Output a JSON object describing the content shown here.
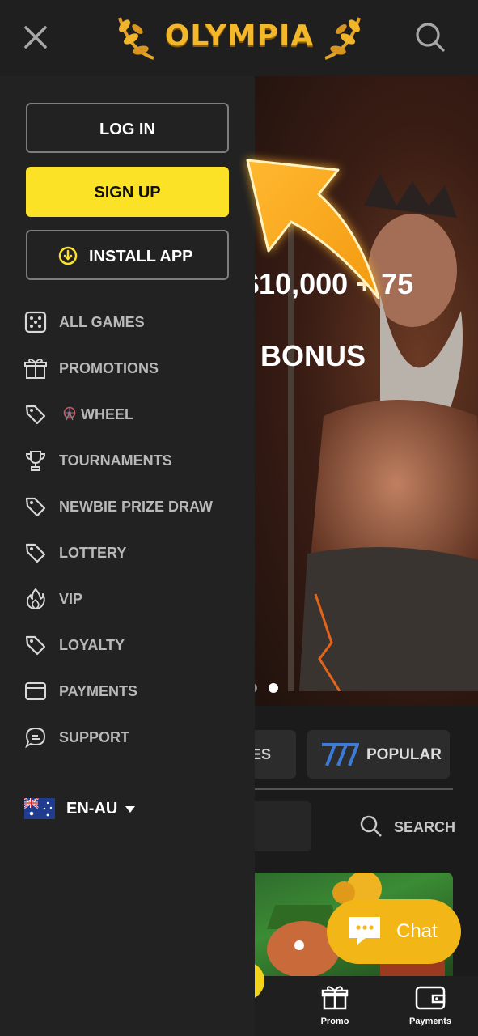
{
  "header": {
    "logo_text": "OLYMPIA",
    "close_icon": "close-icon",
    "search_icon": "search-icon"
  },
  "menu": {
    "login_label": "LOG IN",
    "signup_label": "SIGN UP",
    "install_label": "INSTALL APP",
    "items": [
      {
        "label": "ALL GAMES",
        "icon": "dice-icon"
      },
      {
        "label": "PROMOTIONS",
        "icon": "gift-icon"
      },
      {
        "label": "WHEEL",
        "icon": "tag-icon"
      },
      {
        "label": "TOURNAMENTS",
        "icon": "trophy-icon"
      },
      {
        "label": "NEWBIE PRIZE DRAW",
        "icon": "tag-icon"
      },
      {
        "label": "LOTTERY",
        "icon": "tag-icon"
      },
      {
        "label": "VIP",
        "icon": "flame-icon"
      },
      {
        "label": "LOYALTY",
        "icon": "tag-icon"
      },
      {
        "label": "PAYMENTS",
        "icon": "wallet-icon"
      },
      {
        "label": "SUPPORT",
        "icon": "chat-bubble-icon"
      }
    ],
    "language": "EN-AU"
  },
  "hero": {
    "amount_visible": "$10,000 + 75",
    "bonus_visible": "T BONUS"
  },
  "tabs": {
    "games_partial": "MES",
    "popular_label": "POPULAR"
  },
  "search": {
    "label": "SEARCH"
  },
  "chat": {
    "label": "Chat"
  },
  "bottom_nav": {
    "promo_label": "Promo",
    "payments_label": "Payments"
  },
  "colors": {
    "signup_yellow": "#fbe227",
    "chat_orange": "#f2b617",
    "menu_bg": "#222222",
    "arrow_orange": "#f8a615"
  }
}
